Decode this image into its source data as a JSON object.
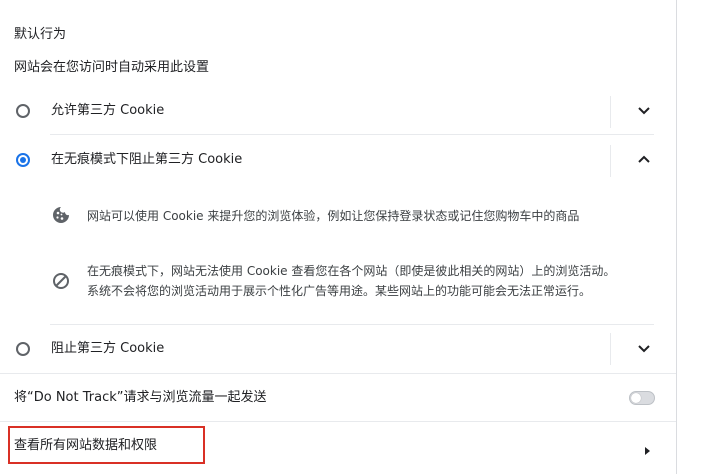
{
  "default_behavior": {
    "heading": "默认行为",
    "description": "网站会在您访问时自动采用此设置"
  },
  "options": [
    {
      "label": "允许第三方 Cookie",
      "selected": false,
      "expanded": false
    },
    {
      "label": "在无痕模式下阻止第三方 Cookie",
      "selected": true,
      "expanded": true
    },
    {
      "label": "阻止第三方 Cookie",
      "selected": false,
      "expanded": false
    }
  ],
  "expanded_details": {
    "item1": {
      "icon": "cookie-icon",
      "text": "网站可以使用 Cookie 来提升您的浏览体验，例如让您保持登录状态或记住您购物车中的商品"
    },
    "item2": {
      "icon": "block-icon",
      "line1": "在无痕模式下，网站无法使用 Cookie 查看您在各个网站（即使是彼此相关的网站）上的浏览活动。",
      "line2": "系统不会将您的浏览活动用于展示个性化广告等用途。某些网站上的功能可能会无法正常运行。"
    }
  },
  "do_not_track": {
    "label": "将“Do Not Track”请求与浏览流量一起发送",
    "enabled": false
  },
  "view_all_site_data": {
    "label": "查看所有网站数据和权限"
  },
  "colors": {
    "accent": "#1a73e8",
    "highlight_box": "#d93025"
  }
}
